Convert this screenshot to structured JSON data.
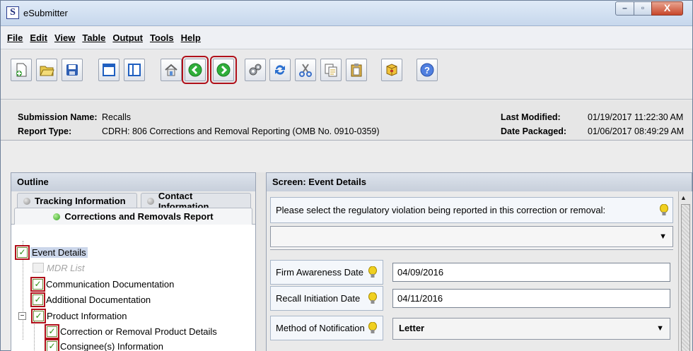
{
  "window": {
    "title": "eSubmitter",
    "icon_letter": "S",
    "controls": {
      "minimize": "–",
      "maximize": "▫",
      "close": "X"
    }
  },
  "menu": [
    {
      "label": "File"
    },
    {
      "label": "Edit"
    },
    {
      "label": "View"
    },
    {
      "label": "Table"
    },
    {
      "label": "Output"
    },
    {
      "label": "Tools"
    },
    {
      "label": "Help"
    }
  ],
  "toolbar": {
    "buttons": [
      {
        "name": "new-document-icon",
        "highlighted": false
      },
      {
        "name": "open-folder-icon",
        "highlighted": false
      },
      {
        "name": "save-icon",
        "highlighted": false
      },
      {
        "name": "window-single-icon",
        "highlighted": false
      },
      {
        "name": "window-split-icon",
        "highlighted": false
      },
      {
        "name": "home-icon",
        "highlighted": false
      },
      {
        "name": "back-arrow-icon",
        "highlighted": true
      },
      {
        "name": "forward-arrow-icon",
        "highlighted": true
      },
      {
        "name": "settings-gears-icon",
        "highlighted": false
      },
      {
        "name": "refresh-icon",
        "highlighted": false
      },
      {
        "name": "cut-icon",
        "highlighted": false
      },
      {
        "name": "copy-icon",
        "highlighted": false
      },
      {
        "name": "paste-icon",
        "highlighted": false
      },
      {
        "name": "package-icon",
        "highlighted": false
      },
      {
        "name": "help-icon",
        "highlighted": false
      }
    ]
  },
  "info": {
    "submission_name_label": "Submission Name:",
    "submission_name": "Recalls",
    "report_type_label": "Report Type:",
    "report_type": "CDRH: 806 Corrections and Removal Reporting (OMB No. 0910-0359)",
    "last_modified_label": "Last Modified:",
    "last_modified": "01/19/2017 11:22:30 AM",
    "date_packaged_label": "Date Packaged:",
    "date_packaged": "01/06/2017 08:49:29 AM"
  },
  "outline": {
    "header": "Outline",
    "tabs": [
      {
        "label": "Tracking Information",
        "status": "gray"
      },
      {
        "label": "Contact Information",
        "status": "gray"
      },
      {
        "label": "Corrections and Removals Report",
        "status": "green"
      }
    ],
    "tree": [
      {
        "label": "Event Details",
        "checked": true,
        "selected": true
      },
      {
        "label": "MDR List",
        "checked": false,
        "disabled": true
      },
      {
        "label": "Communication Documentation",
        "checked": true
      },
      {
        "label": "Additional Documentation",
        "checked": true
      },
      {
        "label": "Product Information",
        "checked": true,
        "expandable": true,
        "expander": "−"
      },
      {
        "label": "Correction or Removal Product Details",
        "checked": true
      },
      {
        "label": "Consignee(s) Information",
        "checked": true
      }
    ]
  },
  "screen": {
    "header": "Screen: Event Details",
    "question": "Please select the regulatory violation being reported in this correction or removal:",
    "violation_value": "",
    "fields": [
      {
        "label": "Firm Awareness Date",
        "value": "04/09/2016"
      },
      {
        "label": "Recall Initiation Date",
        "value": "04/11/2016"
      },
      {
        "label": "Method of Notification",
        "value": "Letter"
      }
    ]
  }
}
